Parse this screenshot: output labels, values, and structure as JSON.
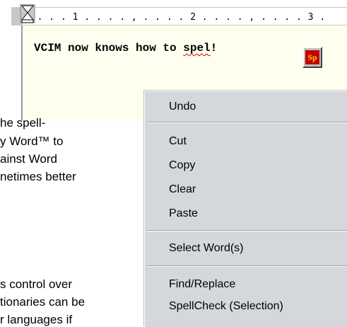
{
  "ruler": {
    "ticks": ". . . . 1 . . . . , . . . . 2 . . . . , . . . . 3 ."
  },
  "editor": {
    "text_before": "VCIM now knows how to ",
    "misspelled_word": "spel",
    "text_after": "!",
    "spell_button_label": "Sp"
  },
  "background_text": {
    "line1": "he spell-",
    "line2": "y Word™ to",
    "line3": "ainst Word",
    "line4": "netimes better",
    "line5": "s control over",
    "line6": "tionaries can be",
    "line7": "r languages if"
  },
  "context_menu": {
    "undo": "Undo",
    "cut": "Cut",
    "copy": "Copy",
    "clear": "Clear",
    "paste": "Paste",
    "select_words": "Select Word(s)",
    "find_replace": "Find/Replace",
    "spellcheck_selection": "SpellCheck (Selection)"
  },
  "colors": {
    "editor_bg": "#fffff0",
    "menu_bg": "#d4d8dc",
    "spell_button_red": "#c00000",
    "spell_button_text": "#ffd200",
    "misspelling_underline": "#e00000"
  }
}
